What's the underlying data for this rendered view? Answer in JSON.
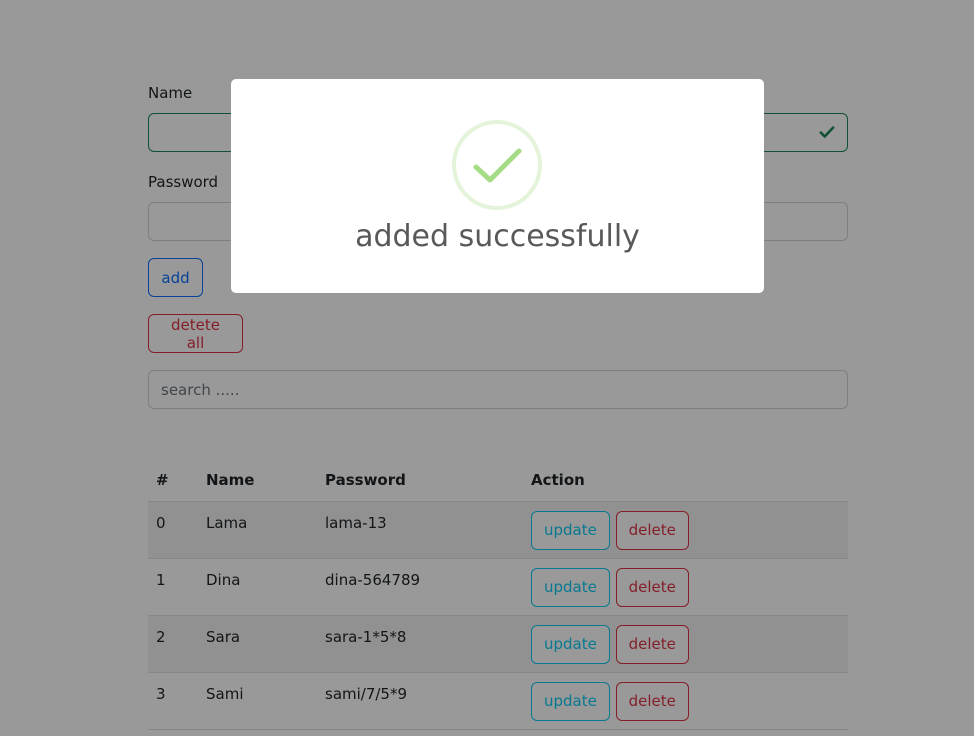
{
  "form": {
    "name_label": "Name",
    "name_value": "",
    "password_label": "Password",
    "password_value": "",
    "add_label": "add",
    "delete_all_label": "detete all",
    "search_placeholder": "search ....."
  },
  "table": {
    "headers": [
      "#",
      "Name",
      "Password",
      "Action"
    ],
    "rows": [
      {
        "index": "0",
        "name": "Lama",
        "password": "lama-13"
      },
      {
        "index": "1",
        "name": "Dina",
        "password": "dina-564789"
      },
      {
        "index": "2",
        "name": "Sara",
        "password": "sara-1*5*8"
      },
      {
        "index": "3",
        "name": "Sami",
        "password": "sami/7/5*9"
      }
    ],
    "update_label": "update",
    "delete_label": "delete"
  },
  "modal": {
    "title": "added successfully",
    "icon": "success-check-icon"
  },
  "colors": {
    "primary": "#0d6efd",
    "danger": "#dc3545",
    "info": "#0dcaf0",
    "success": "#198754",
    "success_icon": "#a5dc86"
  }
}
